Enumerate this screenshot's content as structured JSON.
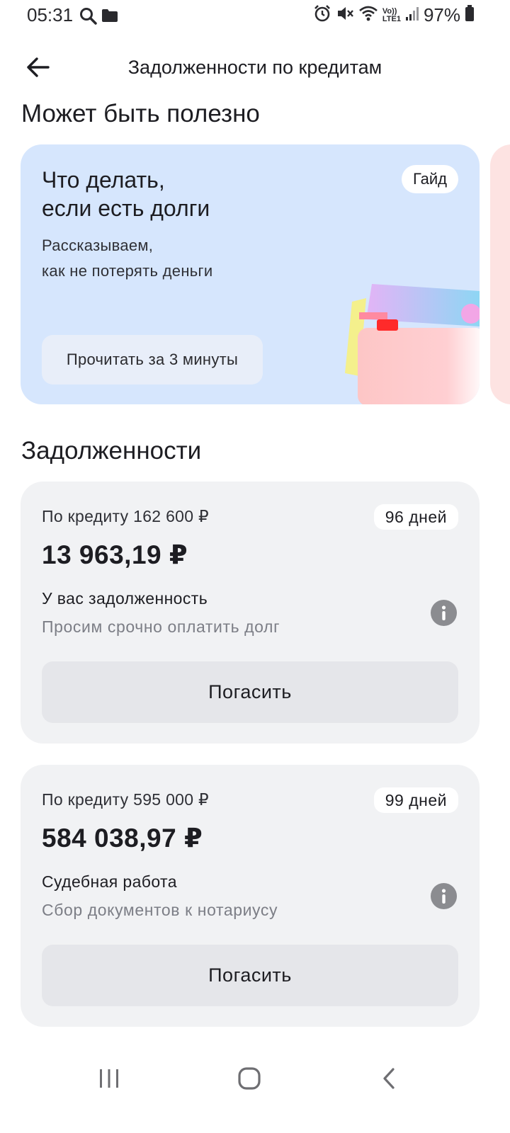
{
  "status_bar": {
    "time": "05:31",
    "battery": "97%",
    "icons": [
      "search-icon",
      "folder-icon",
      "alarm-icon",
      "mute-icon",
      "wifi-icon",
      "volte-icon",
      "signal-icon",
      "battery-icon"
    ],
    "volte_top": "Vo))",
    "volte_bottom": "LTE1"
  },
  "header": {
    "title": "Задолженности по кредитам",
    "back_icon": "arrow-left-icon"
  },
  "useful": {
    "title": "Может быть полезно",
    "card": {
      "title": "Что делать,\nесли есть долги",
      "text": "Рассказываем,\nкак не потерять деньги",
      "badge": "Гайд",
      "button": "Прочитать за 3 минуты",
      "background": "#d6e6fd"
    }
  },
  "debts": {
    "title": "Задолженности",
    "items": [
      {
        "credit_label": "По кредиту 162 600 ₽",
        "days": "96 дней",
        "amount": "13 963,19 ₽",
        "status": "У вас задолженность",
        "subtitle": "Просим срочно оплатить долг",
        "button": "Погасить"
      },
      {
        "credit_label": "По кредиту 595 000 ₽",
        "days": "99 дней",
        "amount": "584 038,97 ₽",
        "status": "Судебная работа",
        "subtitle": "Сбор документов к нотариусу",
        "button": "Погасить"
      }
    ]
  },
  "nav_bar": {
    "icons": [
      "recent-apps-icon",
      "home-icon",
      "back-icon"
    ]
  }
}
